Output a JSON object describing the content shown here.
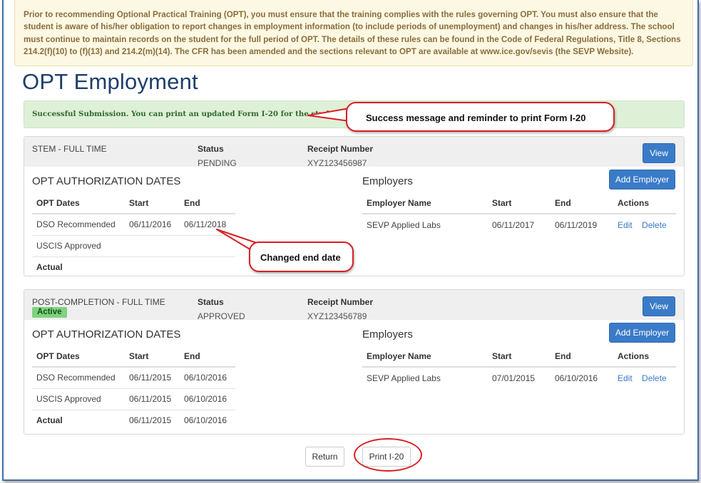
{
  "notice": "Prior to recommending Optional Practical Training (OPT), you must ensure that the training complies with the rules governing OPT. You must also ensure that the student is aware of his/her obligation to report changes in employment information (to include periods of unemployment) and changes in his/her address. The school must continue to maintain records on the student for the full period of OPT. The details of these rules can be found in the Code of Federal Regulations, Title 8, Sections 214.2(f)(10) to (f)(13) and 214.2(m)(14). The CFR has been amended and the sections relevant to OPT are available at www.ice.gov/sevis (the SEVP Website).",
  "page_title": "OPT Employment",
  "success_message": "Successful Submission. You can print an updated Form I-20 for the student.",
  "callouts": {
    "success": "Success message and reminder to print Form I-20",
    "end_date": "Changed end date"
  },
  "labels": {
    "status": "Status",
    "receipt": "Receipt Number",
    "view": "View",
    "add_employer": "Add Employer",
    "auth_dates": "OPT AUTHORIZATION DATES",
    "employers": "Employers",
    "opt_dates": "OPT Dates",
    "start": "Start",
    "end": "End",
    "employer_name": "Employer Name",
    "actions": "Actions",
    "edit": "Edit",
    "delete": "Delete"
  },
  "records": [
    {
      "type": "STEM - FULL TIME",
      "status": "PENDING",
      "receipt": "XYZ123456987",
      "dates": [
        {
          "label": "DSO Recommended",
          "start": "06/11/2016",
          "end": "06/11/2018"
        },
        {
          "label": "USCIS Approved",
          "start": "",
          "end": ""
        },
        {
          "label": "Actual",
          "start": "",
          "end": ""
        }
      ],
      "employers": [
        {
          "name": "SEVP Applied Labs",
          "start": "06/11/2017",
          "end": "06/11/2019"
        }
      ]
    },
    {
      "type": "POST-COMPLETION - FULL TIME",
      "badge": "Active",
      "status": "APPROVED",
      "receipt": "XYZ123456789",
      "dates": [
        {
          "label": "DSO Recommended",
          "start": "06/11/2015",
          "end": "06/10/2016"
        },
        {
          "label": "USCIS Approved",
          "start": "06/11/2015",
          "end": "06/10/2016"
        },
        {
          "label": "Actual",
          "start": "06/11/2015",
          "end": "06/10/2016"
        }
      ],
      "employers": [
        {
          "name": "SEVP Applied Labs",
          "start": "07/01/2015",
          "end": "06/10/2016"
        }
      ]
    }
  ],
  "buttons": {
    "return": "Return",
    "print": "Print I-20"
  },
  "colors": {
    "primary": "#3a7bc8",
    "annotation": "#d81f26",
    "success_bg": "#dff0d8",
    "notice_bg": "#fcf8e3",
    "active_badge": "#7ed37e"
  }
}
